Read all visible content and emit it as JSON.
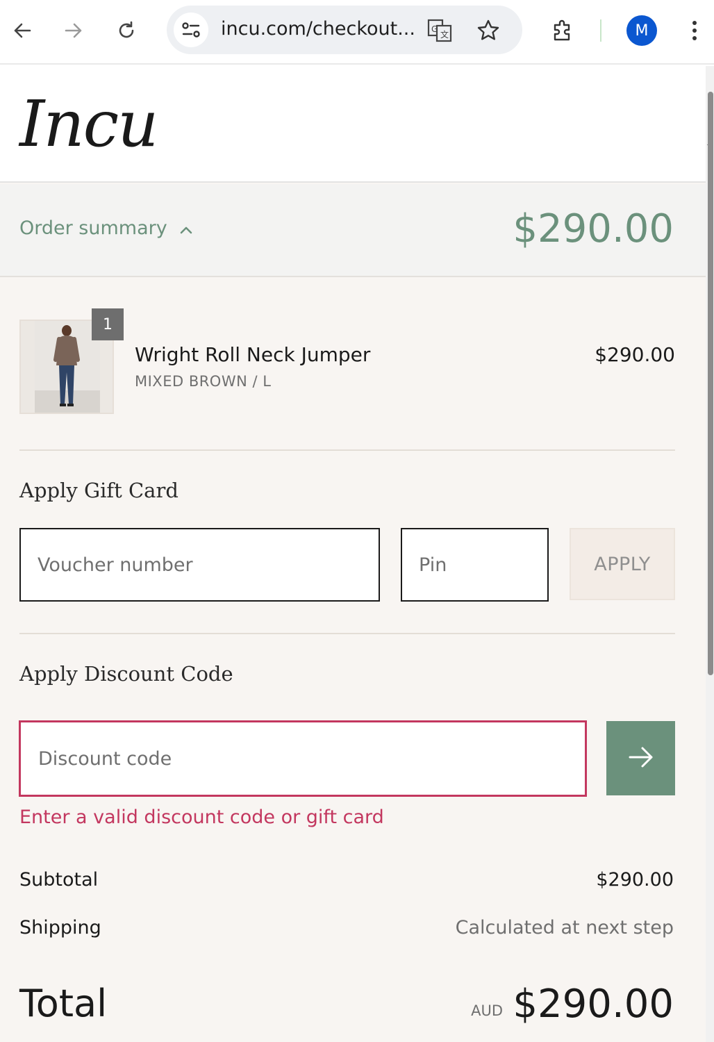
{
  "browser": {
    "url": "incu.com/checkout...",
    "profile_initial": "M",
    "colors": {
      "avatar": "#0b57d0"
    }
  },
  "brand": {
    "logo_text": "Incu"
  },
  "summary": {
    "toggle_label": "Order summary",
    "total": "$290.00"
  },
  "cart": {
    "items": [
      {
        "name": "Wright Roll Neck Jumper",
        "variant": "MIXED BROWN / L",
        "price": "$290.00",
        "quantity": "1"
      }
    ]
  },
  "gift_card": {
    "title": "Apply Gift Card",
    "voucher_placeholder": "Voucher number",
    "pin_placeholder": "Pin",
    "apply_label": "APPLY"
  },
  "discount": {
    "title": "Apply Discount Code",
    "placeholder": "Discount code",
    "error": "Enter a valid discount code or gift card"
  },
  "totals": {
    "subtotal_label": "Subtotal",
    "subtotal_value": "$290.00",
    "shipping_label": "Shipping",
    "shipping_value": "Calculated at next step",
    "total_label": "Total",
    "currency": "AUD",
    "total_value": "$290.00"
  },
  "colors": {
    "accent": "#6b917c",
    "error": "#c3375f",
    "background": "#f8f5f2"
  }
}
